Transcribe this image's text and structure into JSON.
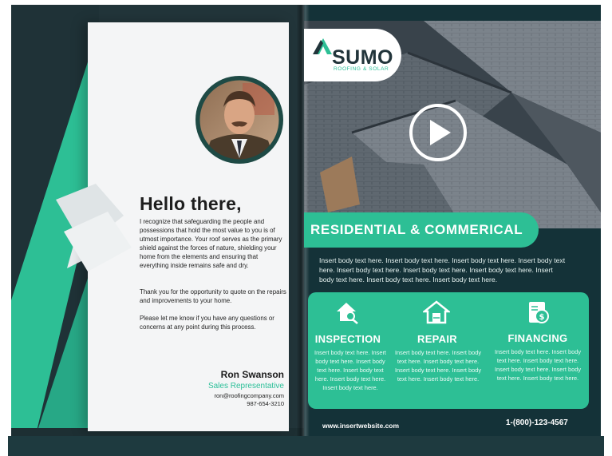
{
  "left": {
    "greeting": "Hello there,",
    "paragraphs": [
      "I recognize that safeguarding the people and possessions that hold the most value to you is of utmost importance. Your roof serves as the primary shield against the forces of nature, shielding your home from the elements and ensuring that everything inside remains safe and dry.",
      "Thank you for the opportunity to quote on the repairs and improvements to your home.",
      "Please let me know if you have any questions or concerns at any point during this process."
    ],
    "signature": {
      "name": "Ron Swanson",
      "title": "Sales Representative",
      "email": "ron@roofingcompany.com",
      "phone": "987-654-3210"
    }
  },
  "right": {
    "logo": {
      "name": "SUMO",
      "tagline": "ROOFING & SOLAR"
    },
    "banner": "RESIDENTIAL & COMMERICAL",
    "body": "Insert body text here. Insert body text here. Insert body text here. Insert body text here. Insert body text here. Insert body text here. Insert body text here. Insert body text here. Insert body text here. Insert body text here.",
    "services": [
      {
        "title": "INSPECTION",
        "icon": "house-magnifier-icon",
        "body": "Insert body text here. Insert body text here. Insert body text here. Insert body text here. Insert body text here. Insert body text here."
      },
      {
        "title": "REPAIR",
        "icon": "house-tools-icon",
        "body": "Insert body text here. Insert body text here. Insert body text here. Insert body text here. Insert body text here. Insert body text here."
      },
      {
        "title": "FINANCING",
        "icon": "document-dollar-icon",
        "body": "Insert body text here. Insert body text here. Insert body text here. Insert body text here. Insert body text here. Insert body text here."
      }
    ],
    "website": "www.insertwebsite.com",
    "phone": "1-(800)-123-4567"
  },
  "colors": {
    "accent": "#2dbf95",
    "dark": "#143238",
    "paper": "#f4f5f6"
  }
}
